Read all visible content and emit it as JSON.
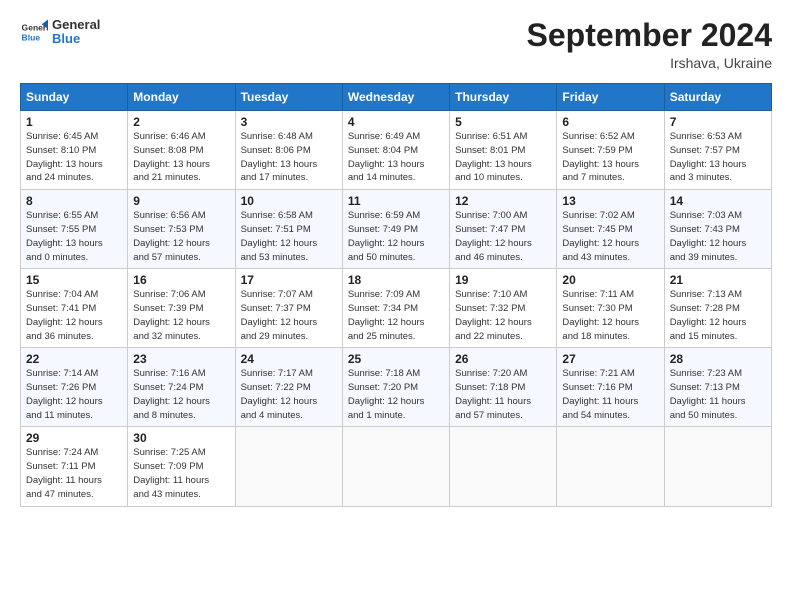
{
  "header": {
    "logo_line1": "General",
    "logo_line2": "Blue",
    "month_title": "September 2024",
    "location": "Irshava, Ukraine"
  },
  "days_of_week": [
    "Sunday",
    "Monday",
    "Tuesday",
    "Wednesday",
    "Thursday",
    "Friday",
    "Saturday"
  ],
  "weeks": [
    [
      {
        "day": "1",
        "lines": [
          "Sunrise: 6:45 AM",
          "Sunset: 8:10 PM",
          "Daylight: 13 hours",
          "and 24 minutes."
        ]
      },
      {
        "day": "2",
        "lines": [
          "Sunrise: 6:46 AM",
          "Sunset: 8:08 PM",
          "Daylight: 13 hours",
          "and 21 minutes."
        ]
      },
      {
        "day": "3",
        "lines": [
          "Sunrise: 6:48 AM",
          "Sunset: 8:06 PM",
          "Daylight: 13 hours",
          "and 17 minutes."
        ]
      },
      {
        "day": "4",
        "lines": [
          "Sunrise: 6:49 AM",
          "Sunset: 8:04 PM",
          "Daylight: 13 hours",
          "and 14 minutes."
        ]
      },
      {
        "day": "5",
        "lines": [
          "Sunrise: 6:51 AM",
          "Sunset: 8:01 PM",
          "Daylight: 13 hours",
          "and 10 minutes."
        ]
      },
      {
        "day": "6",
        "lines": [
          "Sunrise: 6:52 AM",
          "Sunset: 7:59 PM",
          "Daylight: 13 hours",
          "and 7 minutes."
        ]
      },
      {
        "day": "7",
        "lines": [
          "Sunrise: 6:53 AM",
          "Sunset: 7:57 PM",
          "Daylight: 13 hours",
          "and 3 minutes."
        ]
      }
    ],
    [
      {
        "day": "8",
        "lines": [
          "Sunrise: 6:55 AM",
          "Sunset: 7:55 PM",
          "Daylight: 13 hours",
          "and 0 minutes."
        ]
      },
      {
        "day": "9",
        "lines": [
          "Sunrise: 6:56 AM",
          "Sunset: 7:53 PM",
          "Daylight: 12 hours",
          "and 57 minutes."
        ]
      },
      {
        "day": "10",
        "lines": [
          "Sunrise: 6:58 AM",
          "Sunset: 7:51 PM",
          "Daylight: 12 hours",
          "and 53 minutes."
        ]
      },
      {
        "day": "11",
        "lines": [
          "Sunrise: 6:59 AM",
          "Sunset: 7:49 PM",
          "Daylight: 12 hours",
          "and 50 minutes."
        ]
      },
      {
        "day": "12",
        "lines": [
          "Sunrise: 7:00 AM",
          "Sunset: 7:47 PM",
          "Daylight: 12 hours",
          "and 46 minutes."
        ]
      },
      {
        "day": "13",
        "lines": [
          "Sunrise: 7:02 AM",
          "Sunset: 7:45 PM",
          "Daylight: 12 hours",
          "and 43 minutes."
        ]
      },
      {
        "day": "14",
        "lines": [
          "Sunrise: 7:03 AM",
          "Sunset: 7:43 PM",
          "Daylight: 12 hours",
          "and 39 minutes."
        ]
      }
    ],
    [
      {
        "day": "15",
        "lines": [
          "Sunrise: 7:04 AM",
          "Sunset: 7:41 PM",
          "Daylight: 12 hours",
          "and 36 minutes."
        ]
      },
      {
        "day": "16",
        "lines": [
          "Sunrise: 7:06 AM",
          "Sunset: 7:39 PM",
          "Daylight: 12 hours",
          "and 32 minutes."
        ]
      },
      {
        "day": "17",
        "lines": [
          "Sunrise: 7:07 AM",
          "Sunset: 7:37 PM",
          "Daylight: 12 hours",
          "and 29 minutes."
        ]
      },
      {
        "day": "18",
        "lines": [
          "Sunrise: 7:09 AM",
          "Sunset: 7:34 PM",
          "Daylight: 12 hours",
          "and 25 minutes."
        ]
      },
      {
        "day": "19",
        "lines": [
          "Sunrise: 7:10 AM",
          "Sunset: 7:32 PM",
          "Daylight: 12 hours",
          "and 22 minutes."
        ]
      },
      {
        "day": "20",
        "lines": [
          "Sunrise: 7:11 AM",
          "Sunset: 7:30 PM",
          "Daylight: 12 hours",
          "and 18 minutes."
        ]
      },
      {
        "day": "21",
        "lines": [
          "Sunrise: 7:13 AM",
          "Sunset: 7:28 PM",
          "Daylight: 12 hours",
          "and 15 minutes."
        ]
      }
    ],
    [
      {
        "day": "22",
        "lines": [
          "Sunrise: 7:14 AM",
          "Sunset: 7:26 PM",
          "Daylight: 12 hours",
          "and 11 minutes."
        ]
      },
      {
        "day": "23",
        "lines": [
          "Sunrise: 7:16 AM",
          "Sunset: 7:24 PM",
          "Daylight: 12 hours",
          "and 8 minutes."
        ]
      },
      {
        "day": "24",
        "lines": [
          "Sunrise: 7:17 AM",
          "Sunset: 7:22 PM",
          "Daylight: 12 hours",
          "and 4 minutes."
        ]
      },
      {
        "day": "25",
        "lines": [
          "Sunrise: 7:18 AM",
          "Sunset: 7:20 PM",
          "Daylight: 12 hours",
          "and 1 minute."
        ]
      },
      {
        "day": "26",
        "lines": [
          "Sunrise: 7:20 AM",
          "Sunset: 7:18 PM",
          "Daylight: 11 hours",
          "and 57 minutes."
        ]
      },
      {
        "day": "27",
        "lines": [
          "Sunrise: 7:21 AM",
          "Sunset: 7:16 PM",
          "Daylight: 11 hours",
          "and 54 minutes."
        ]
      },
      {
        "day": "28",
        "lines": [
          "Sunrise: 7:23 AM",
          "Sunset: 7:13 PM",
          "Daylight: 11 hours",
          "and 50 minutes."
        ]
      }
    ],
    [
      {
        "day": "29",
        "lines": [
          "Sunrise: 7:24 AM",
          "Sunset: 7:11 PM",
          "Daylight: 11 hours",
          "and 47 minutes."
        ]
      },
      {
        "day": "30",
        "lines": [
          "Sunrise: 7:25 AM",
          "Sunset: 7:09 PM",
          "Daylight: 11 hours",
          "and 43 minutes."
        ]
      },
      null,
      null,
      null,
      null,
      null
    ]
  ]
}
